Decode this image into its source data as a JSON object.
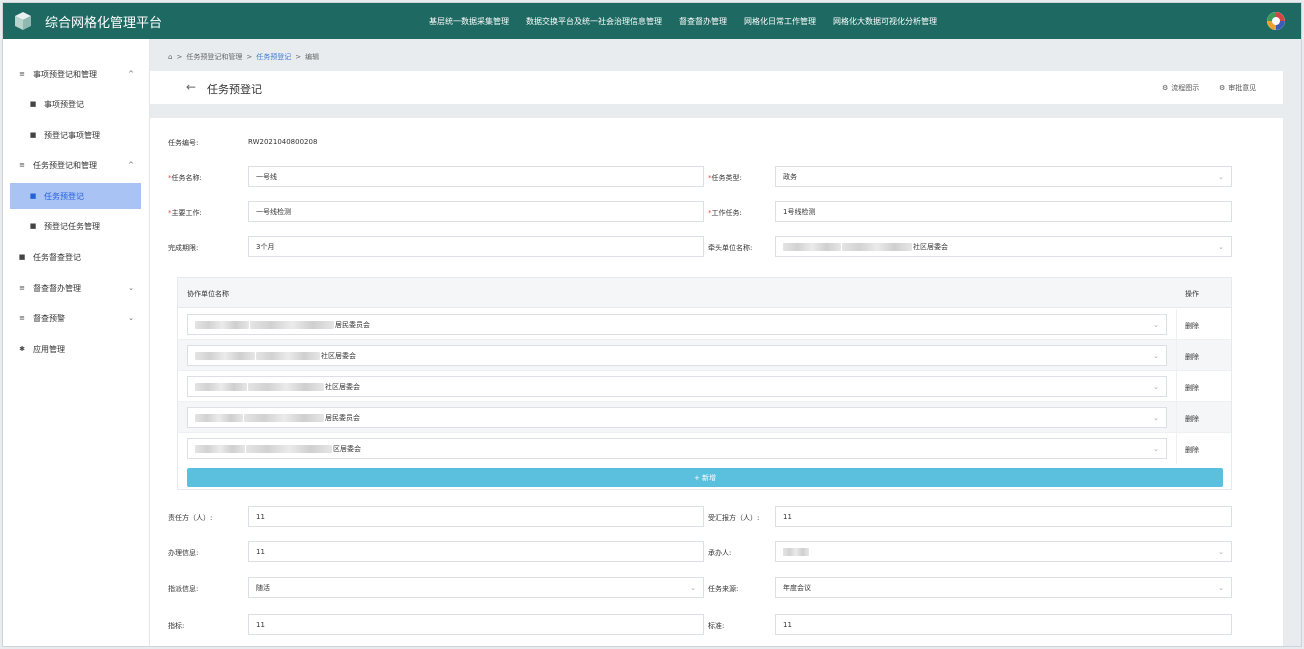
{
  "app": {
    "title": "综合网格化管理平台"
  },
  "topnav": [
    "基层统一数据采集管理",
    "数据交换平台及统一社会治理信息管理",
    "督查督办管理",
    "网格化日常工作管理",
    "网格化大数据可视化分析管理"
  ],
  "sidebar": {
    "items": [
      {
        "label": "事项预登记和管理",
        "icon": "list-icon",
        "chevron": "^"
      },
      {
        "label": "事项预登记",
        "icon": "doc-icon"
      },
      {
        "label": "预登记事项管理",
        "icon": "doc-icon"
      },
      {
        "label": "任务预登记和管理",
        "icon": "list-icon",
        "chevron": "^"
      },
      {
        "label": "任务预登记",
        "icon": "doc-icon"
      },
      {
        "label": "预登记任务管理",
        "icon": "doc-icon"
      },
      {
        "label": "任务督查登记",
        "icon": "doc-icon"
      },
      {
        "label": "督查督办管理",
        "icon": "list-icon",
        "chevron": "v"
      },
      {
        "label": "督查预警",
        "icon": "list-icon",
        "chevron": "v"
      },
      {
        "label": "应用管理",
        "icon": "gear-icon"
      }
    ]
  },
  "breadcrumb": {
    "items": [
      "任务预登记和管理",
      "任务预登记",
      "编辑"
    ],
    "sep": ">"
  },
  "header": {
    "title": "任务预登记",
    "back": "←",
    "actions": [
      "流程图示",
      "审批意见"
    ]
  },
  "form": {
    "task_no_label": "任务编号:",
    "task_no": "RW2021040800208",
    "task_name_label": "任务名称:",
    "task_name": "一号线",
    "task_type_label": "任务类型:",
    "task_type": "政务",
    "main_work_label": "主要工作:",
    "main_work": "一号线检测",
    "work_task_label": "工作任务:",
    "work_task": "1号线检测",
    "deadline_label": "完成期限:",
    "deadline": "3个月",
    "lead_unit_label": "牵头单位名称:",
    "lead_unit_suffix": "社区居委会",
    "co_units_header": "协作单位名称",
    "ops_header": "操作",
    "co_units": [
      {
        "suffix": "居民委员会"
      },
      {
        "suffix": "社区居委会"
      },
      {
        "suffix": "社区居委会"
      },
      {
        "suffix": "居民委员会"
      },
      {
        "suffix": "区居委会"
      }
    ],
    "delete_label": "删除",
    "add_label": "+ 新增",
    "responsible_label": "责任方（人）:",
    "responsible": "11",
    "report_to_label": "受汇报方（人）:",
    "report_to": "11",
    "handle_info_label": "办理信息:",
    "handle_info": "11",
    "handler_label": "承办人:",
    "dispatch_label": "指派信息:",
    "dispatch": "随活",
    "source_label": "任务来源:",
    "source": "年度会议",
    "indicator_label": "指标:",
    "indicator": "11",
    "standard_label": "标准:",
    "standard": "11"
  },
  "colors": {
    "topbar": "#1e6a63",
    "active_bg": "#a9c3f5",
    "active_text": "#2561d9",
    "add_button": "#5bc0de",
    "required": "#e74c3c"
  }
}
